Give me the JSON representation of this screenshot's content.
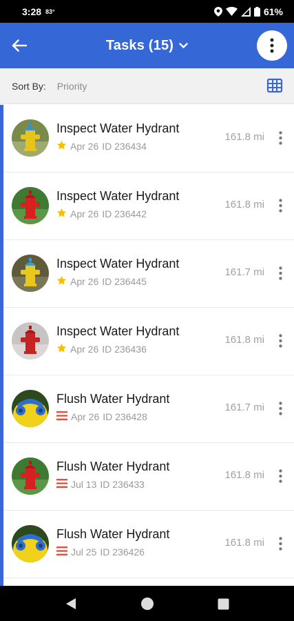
{
  "status": {
    "time": "3:28",
    "temperature": "83°",
    "battery": "61%"
  },
  "appbar": {
    "title": "Tasks (15)"
  },
  "sort": {
    "label": "Sort By:",
    "value": "Priority"
  },
  "colors": {
    "primary": "#3667d6",
    "star": "#f5c000",
    "priority_lines": "#e0503a"
  },
  "tasks": [
    {
      "title": "Inspect Water Hydrant",
      "priority_icon": "star-icon",
      "date": "Apr 26",
      "id": "ID 236434",
      "distance": "161.8 mi",
      "hydrant": "yellow-blue-grass"
    },
    {
      "title": "Inspect Water Hydrant",
      "priority_icon": "star-icon",
      "date": "Apr 26",
      "id": "ID 236442",
      "distance": "161.8 mi",
      "hydrant": "red-green"
    },
    {
      "title": "Inspect Water Hydrant",
      "priority_icon": "star-icon",
      "date": "Apr 26",
      "id": "ID 236445",
      "distance": "161.7 mi",
      "hydrant": "yellow-blue-brown"
    },
    {
      "title": "Inspect Water Hydrant",
      "priority_icon": "star-icon",
      "date": "Apr 26",
      "id": "ID 236436",
      "distance": "161.8 mi",
      "hydrant": "red-pale"
    },
    {
      "title": "Flush Water Hydrant",
      "priority_icon": "priority-lines-icon",
      "date": "Apr 26",
      "id": "ID 236428",
      "distance": "161.7 mi",
      "hydrant": "yellow-closeup"
    },
    {
      "title": "Flush Water Hydrant",
      "priority_icon": "priority-lines-icon",
      "date": "Jul 13",
      "id": "ID 236433",
      "distance": "161.8 mi",
      "hydrant": "red-green"
    },
    {
      "title": "Flush Water Hydrant",
      "priority_icon": "priority-lines-icon",
      "date": "Jul 25",
      "id": "ID 236426",
      "distance": "161.8 mi",
      "hydrant": "yellow-closeup"
    }
  ]
}
